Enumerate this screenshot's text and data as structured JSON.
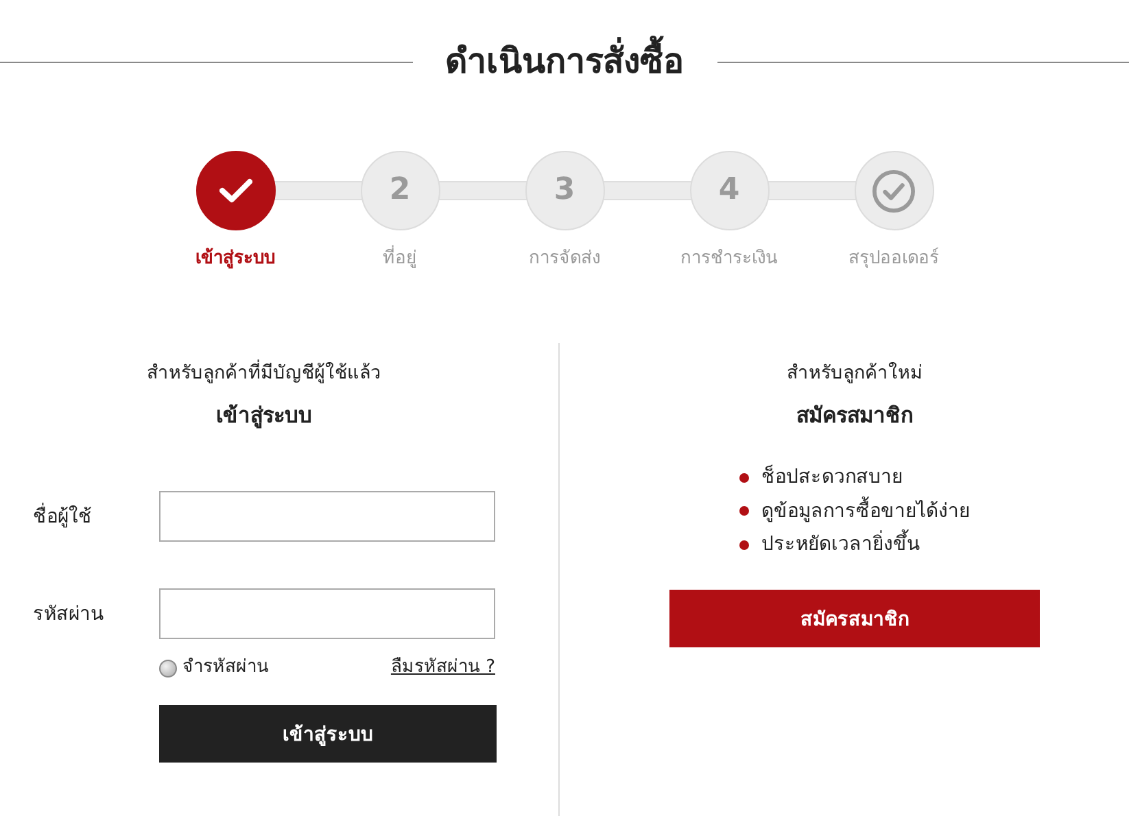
{
  "page_title": "ดำเนินการสั่งซื้อ",
  "steps": [
    {
      "kind": "check",
      "label": "เข้าสู่ระบบ",
      "selected": true
    },
    {
      "kind": "number",
      "number": "2",
      "label": "ที่อยู่",
      "selected": false
    },
    {
      "kind": "number",
      "number": "3",
      "label": "การจัดส่ง",
      "selected": false
    },
    {
      "kind": "number",
      "number": "4",
      "label": "การชำระเงิน",
      "selected": false
    },
    {
      "kind": "circle-check",
      "label": "สรุปออเดอร์",
      "selected": false
    }
  ],
  "login": {
    "subtitle": "สำหรับลูกค้าที่มีบัญชีผู้ใช้แล้ว",
    "heading": "เข้าสู่ระบบ",
    "fields": [
      {
        "label": "ชื่อผู้ใช้"
      },
      {
        "label": "รหัสผ่าน"
      }
    ],
    "remember": {
      "label": "จำรหัสผ่าน",
      "checked": false
    },
    "forgot_link": "ลืมรหัสผ่าน ?",
    "submit": "เข้าสู่ระบบ"
  },
  "register": {
    "subtitle": "สำหรับลูกค้าใหม่",
    "heading": "สมัครสมาชิก",
    "benefits": [
      "ช็อปสะดวกสบาย",
      "ดูข้อมูลการซื้อขายได้ง่าย",
      "ประหยัดเวลายิ่งขึ้น"
    ],
    "button": "สมัครสมาชิก"
  }
}
